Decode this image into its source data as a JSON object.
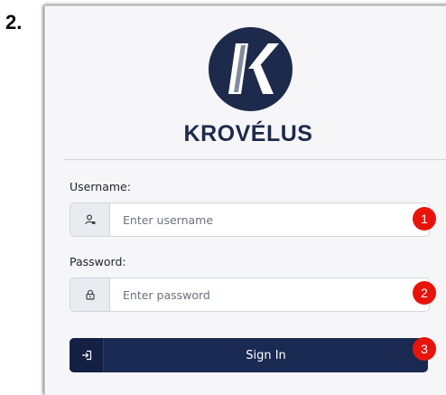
{
  "step_label": "2.",
  "brand": {
    "name": "KROVÉLUS",
    "logo_letter": "K",
    "color": "#1e2a4c"
  },
  "form": {
    "username": {
      "label": "Username:",
      "placeholder": "Enter username",
      "icon": "user-icon"
    },
    "password": {
      "label": "Password:",
      "placeholder": "Enter password",
      "icon": "lock-icon"
    },
    "submit": {
      "label": "Sign In",
      "icon": "sign-in-icon"
    }
  },
  "annotations": [
    "1",
    "2",
    "3"
  ],
  "colors": {
    "button": "#1a2a52",
    "badge": "#e8140c",
    "card": "#f6f6f8"
  }
}
